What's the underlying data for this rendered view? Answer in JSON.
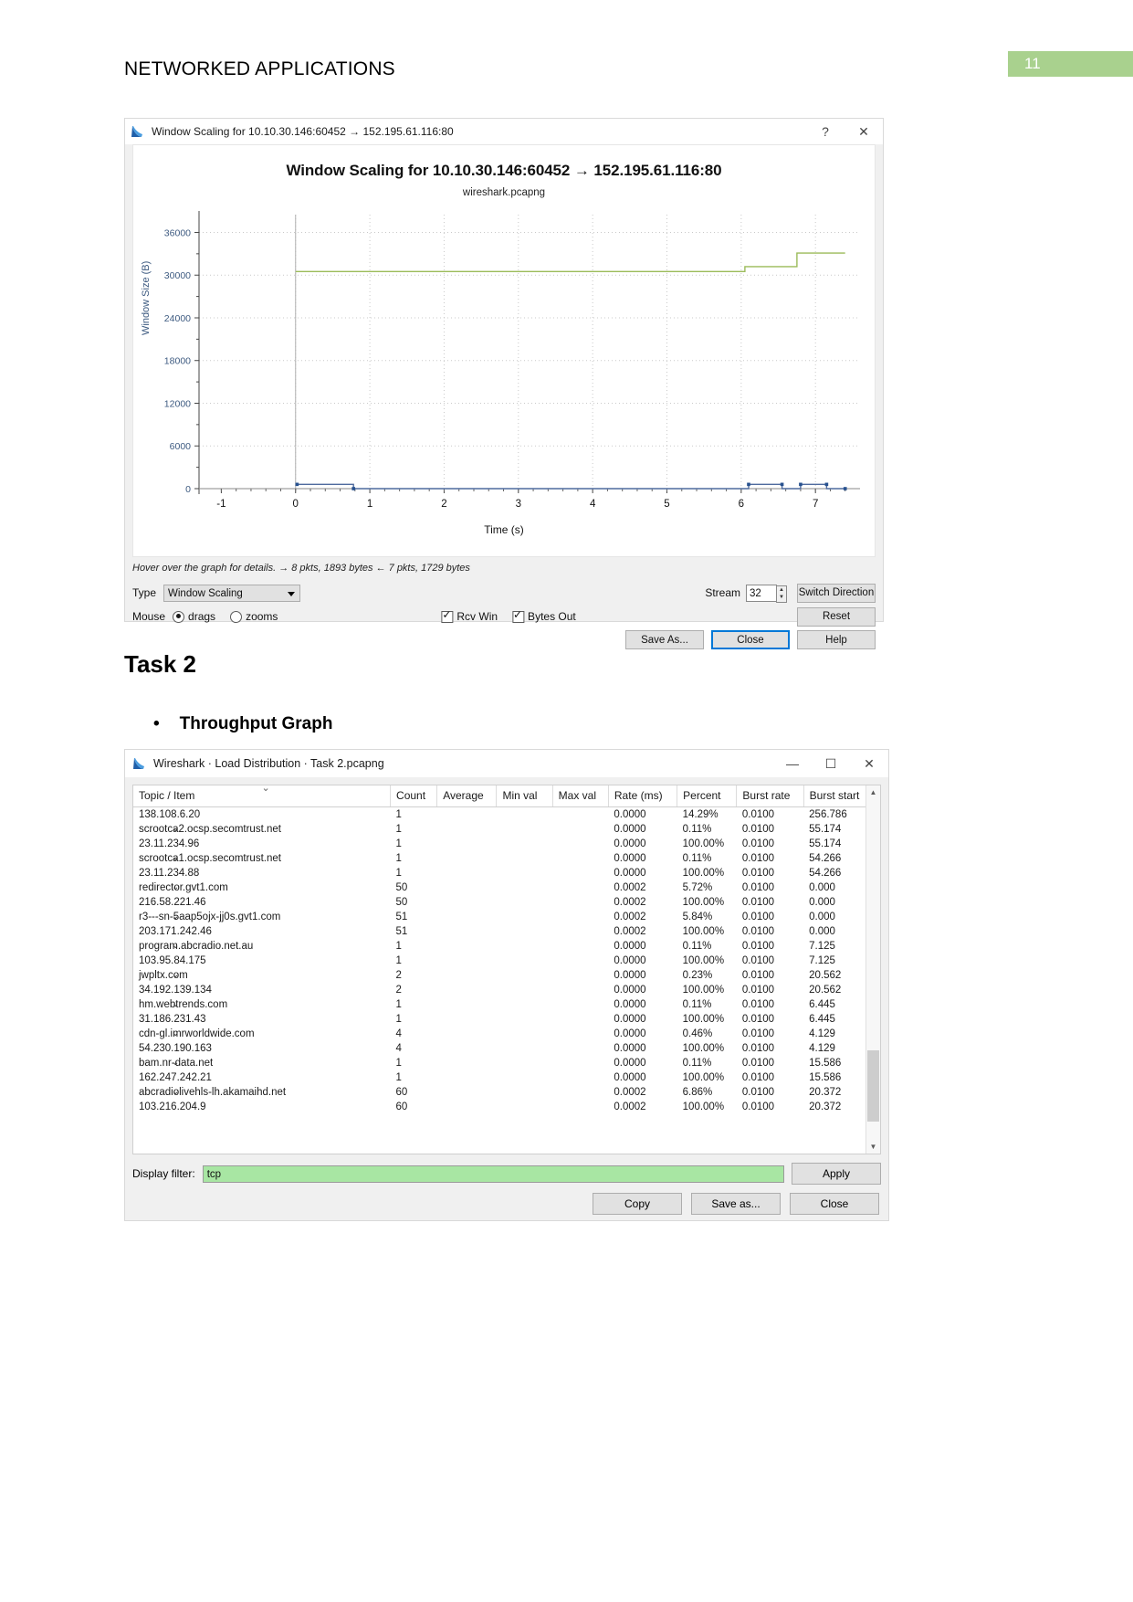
{
  "document": {
    "header_title": "NETWORKED APPLICATIONS",
    "page_number": "11",
    "accent_color": "#a9d18e"
  },
  "window_scaling": {
    "titlebar": {
      "title": "Window Scaling for 10.10.30.146:60452 → 152.195.61.116:80",
      "help_label": "?",
      "close_label": "✕",
      "icon": "wireshark-icon"
    },
    "chart_title": "Window Scaling for 10.10.30.146:60452 → 152.195.61.116:80",
    "chart_subtitle": "wireshark.pcapng",
    "hint": "Hover over the graph for details. → 8 pkts, 1893 bytes ← 7 pkts, 1729 bytes",
    "type_label": "Type",
    "type_value": "Window Scaling",
    "stream_label": "Stream",
    "stream_value": "32",
    "switch_direction_label": "Switch Direction",
    "mouse_label": "Mouse",
    "mouse_drags_label": "drags",
    "mouse_zooms_label": "zooms",
    "rcv_win_label": "Rcv Win",
    "bytes_out_label": "Bytes Out",
    "save_as_label": "Save As...",
    "close_label": "Close",
    "help_label": "Help",
    "reset_label": "Reset"
  },
  "chart_data": {
    "type": "line",
    "title": "Window Scaling for 10.10.30.146:60452 → 152.195.61.116:80",
    "subtitle": "wireshark.pcapng",
    "xlabel": "Time (s)",
    "ylabel": "Window Size (B)",
    "xlim": [
      -1.3,
      7.6
    ],
    "ylim": [
      0,
      38500
    ],
    "xticks": [
      -1,
      0,
      1,
      2,
      3,
      4,
      5,
      6,
      7
    ],
    "yticks": [
      0,
      6000,
      12000,
      18000,
      24000,
      30000,
      36000
    ],
    "grid": true,
    "legend_position": "none",
    "series": [
      {
        "name": "Rcv Win",
        "color": "#9bbb59",
        "points": [
          [
            0.0,
            30500
          ],
          [
            6.05,
            30500
          ],
          [
            6.05,
            31200
          ],
          [
            6.75,
            31200
          ],
          [
            6.75,
            33100
          ],
          [
            7.4,
            33100
          ]
        ]
      },
      {
        "name": "Bytes Out",
        "color": "#4f6b9e",
        "points": [
          [
            0.02,
            600
          ],
          [
            0.78,
            600
          ],
          [
            0.78,
            0
          ],
          [
            6.1,
            0
          ],
          [
            6.1,
            600
          ],
          [
            6.55,
            600
          ],
          [
            6.55,
            0
          ],
          [
            6.8,
            0
          ],
          [
            6.8,
            600
          ],
          [
            7.15,
            600
          ],
          [
            7.15,
            0
          ],
          [
            7.4,
            0
          ]
        ]
      }
    ],
    "markers": [
      [
        0.02,
        600
      ],
      [
        0.78,
        0
      ],
      [
        6.1,
        600
      ],
      [
        6.55,
        600
      ],
      [
        6.8,
        600
      ],
      [
        7.15,
        600
      ],
      [
        7.4,
        0
      ]
    ]
  },
  "task": {
    "heading": "Task 2",
    "bullet_glyph": "•",
    "bullet_label": "Throughput Graph"
  },
  "load_distribution": {
    "titlebar": {
      "title": "Wireshark · Load Distribution · Task 2.pcapng",
      "minimize_label": "—",
      "maximize_label": "☐",
      "close_label": "✕",
      "icon": "wireshark-icon"
    },
    "columns": [
      "Topic / Item",
      "Count",
      "Average",
      "Min val",
      "Max val",
      "Rate (ms)",
      "Percent",
      "Burst rate",
      "Burst start"
    ],
    "rows": [
      {
        "level": 2,
        "expander": false,
        "item": "138.108.6.20",
        "count": "1",
        "average": "",
        "min": "",
        "max": "",
        "rate": "0.0000",
        "percent": "14.29%",
        "burst_rate": "0.0100",
        "burst_start": "256.786"
      },
      {
        "level": 1,
        "expander": true,
        "item": "scrootca2.ocsp.secomtrust.net",
        "count": "1",
        "average": "",
        "min": "",
        "max": "",
        "rate": "0.0000",
        "percent": "0.11%",
        "burst_rate": "0.0100",
        "burst_start": "55.174"
      },
      {
        "level": 2,
        "expander": false,
        "item": "23.11.234.96",
        "count": "1",
        "average": "",
        "min": "",
        "max": "",
        "rate": "0.0000",
        "percent": "100.00%",
        "burst_rate": "0.0100",
        "burst_start": "55.174"
      },
      {
        "level": 1,
        "expander": true,
        "item": "scrootca1.ocsp.secomtrust.net",
        "count": "1",
        "average": "",
        "min": "",
        "max": "",
        "rate": "0.0000",
        "percent": "0.11%",
        "burst_rate": "0.0100",
        "burst_start": "54.266"
      },
      {
        "level": 2,
        "expander": false,
        "item": "23.11.234.88",
        "count": "1",
        "average": "",
        "min": "",
        "max": "",
        "rate": "0.0000",
        "percent": "100.00%",
        "burst_rate": "0.0100",
        "burst_start": "54.266"
      },
      {
        "level": 1,
        "expander": true,
        "item": "redirector.gvt1.com",
        "count": "50",
        "average": "",
        "min": "",
        "max": "",
        "rate": "0.0002",
        "percent": "5.72%",
        "burst_rate": "0.0100",
        "burst_start": "0.000"
      },
      {
        "level": 2,
        "expander": false,
        "item": "216.58.221.46",
        "count": "50",
        "average": "",
        "min": "",
        "max": "",
        "rate": "0.0002",
        "percent": "100.00%",
        "burst_rate": "0.0100",
        "burst_start": "0.000"
      },
      {
        "level": 1,
        "expander": true,
        "item": "r3---sn-5aap5ojx-jj0s.gvt1.com",
        "count": "51",
        "average": "",
        "min": "",
        "max": "",
        "rate": "0.0002",
        "percent": "5.84%",
        "burst_rate": "0.0100",
        "burst_start": "0.000"
      },
      {
        "level": 2,
        "expander": false,
        "item": "203.171.242.46",
        "count": "51",
        "average": "",
        "min": "",
        "max": "",
        "rate": "0.0002",
        "percent": "100.00%",
        "burst_rate": "0.0100",
        "burst_start": "0.000"
      },
      {
        "level": 1,
        "expander": true,
        "item": "program.abcradio.net.au",
        "count": "1",
        "average": "",
        "min": "",
        "max": "",
        "rate": "0.0000",
        "percent": "0.11%",
        "burst_rate": "0.0100",
        "burst_start": "7.125"
      },
      {
        "level": 2,
        "expander": false,
        "item": "103.95.84.175",
        "count": "1",
        "average": "",
        "min": "",
        "max": "",
        "rate": "0.0000",
        "percent": "100.00%",
        "burst_rate": "0.0100",
        "burst_start": "7.125"
      },
      {
        "level": 1,
        "expander": true,
        "item": "jwpltx.com",
        "count": "2",
        "average": "",
        "min": "",
        "max": "",
        "rate": "0.0000",
        "percent": "0.23%",
        "burst_rate": "0.0100",
        "burst_start": "20.562"
      },
      {
        "level": 2,
        "expander": false,
        "item": "34.192.139.134",
        "count": "2",
        "average": "",
        "min": "",
        "max": "",
        "rate": "0.0000",
        "percent": "100.00%",
        "burst_rate": "0.0100",
        "burst_start": "20.562"
      },
      {
        "level": 1,
        "expander": true,
        "item": "hm.webtrends.com",
        "count": "1",
        "average": "",
        "min": "",
        "max": "",
        "rate": "0.0000",
        "percent": "0.11%",
        "burst_rate": "0.0100",
        "burst_start": "6.445"
      },
      {
        "level": 2,
        "expander": false,
        "item": "31.186.231.43",
        "count": "1",
        "average": "",
        "min": "",
        "max": "",
        "rate": "0.0000",
        "percent": "100.00%",
        "burst_rate": "0.0100",
        "burst_start": "6.445"
      },
      {
        "level": 1,
        "expander": true,
        "item": "cdn-gl.imrworldwide.com",
        "count": "4",
        "average": "",
        "min": "",
        "max": "",
        "rate": "0.0000",
        "percent": "0.46%",
        "burst_rate": "0.0100",
        "burst_start": "4.129"
      },
      {
        "level": 2,
        "expander": false,
        "item": "54.230.190.163",
        "count": "4",
        "average": "",
        "min": "",
        "max": "",
        "rate": "0.0000",
        "percent": "100.00%",
        "burst_rate": "0.0100",
        "burst_start": "4.129"
      },
      {
        "level": 1,
        "expander": true,
        "item": "bam.nr-data.net",
        "count": "1",
        "average": "",
        "min": "",
        "max": "",
        "rate": "0.0000",
        "percent": "0.11%",
        "burst_rate": "0.0100",
        "burst_start": "15.586"
      },
      {
        "level": 2,
        "expander": false,
        "item": "162.247.242.21",
        "count": "1",
        "average": "",
        "min": "",
        "max": "",
        "rate": "0.0000",
        "percent": "100.00%",
        "burst_rate": "0.0100",
        "burst_start": "15.586"
      },
      {
        "level": 1,
        "expander": true,
        "item": "abcradiolivehls-lh.akamaihd.net",
        "count": "60",
        "average": "",
        "min": "",
        "max": "",
        "rate": "0.0002",
        "percent": "6.86%",
        "burst_rate": "0.0100",
        "burst_start": "20.372"
      },
      {
        "level": 2,
        "expander": false,
        "item": "103.216.204.9",
        "count": "60",
        "average": "",
        "min": "",
        "max": "",
        "rate": "0.0002",
        "percent": "100.00%",
        "burst_rate": "0.0100",
        "burst_start": "20.372"
      }
    ],
    "display_filter_label": "Display filter:",
    "display_filter_value": "tcp",
    "apply_label": "Apply",
    "copy_label": "Copy",
    "save_as_label": "Save as...",
    "close_label": "Close"
  }
}
